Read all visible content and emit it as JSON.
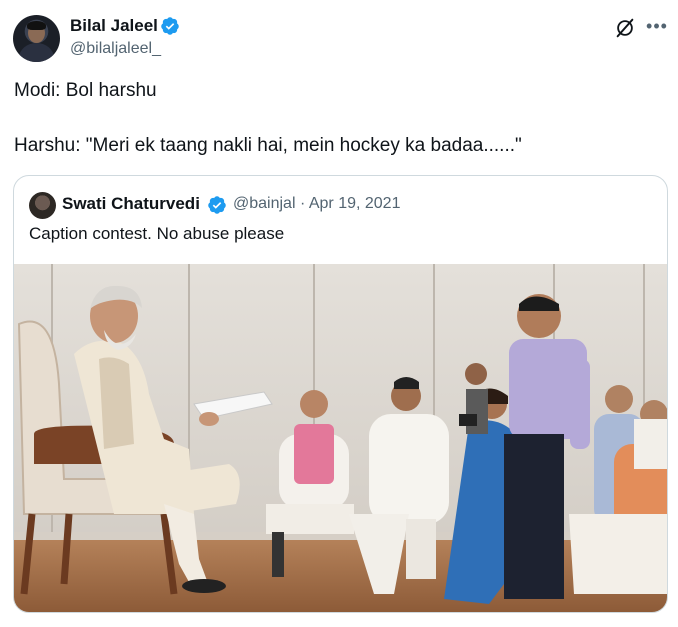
{
  "tweet": {
    "author_name": "Bilal Jaleel",
    "author_handle": "@bilaljaleel_",
    "text_line1": "Modi: Bol harshu",
    "text_line2": "Harshu: \"Meri ek taang nakli hai, mein hockey ka badaa......\"",
    "verified_color": "#1d9bf0",
    "icons": {
      "grok": "grok-icon",
      "more": "more-icon",
      "verified": "verified-badge-icon"
    }
  },
  "quoted_tweet": {
    "author_name": "Swati Chaturvedi",
    "author_handle": "@bainjal",
    "separator": "·",
    "date": "Apr 19, 2021",
    "text": "Caption contest. No abuse please"
  }
}
